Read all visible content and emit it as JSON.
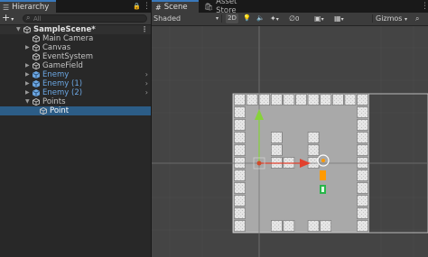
{
  "hierarchy": {
    "tab_label": "Hierarchy",
    "tab_icon": "☰",
    "lock_icon": "🔒",
    "menu_icon": "⋮",
    "add_label": "+",
    "add_caret": "▾",
    "search_placeholder": "All",
    "scene": {
      "name": "SampleScene*",
      "arrow": "▼",
      "more": "⋮"
    },
    "items": [
      {
        "label": "Main Camera",
        "indent": 1,
        "arrow": "",
        "prefab": false,
        "chevron": ""
      },
      {
        "label": "Canvas",
        "indent": 1,
        "arrow": "▶",
        "prefab": false,
        "chevron": ""
      },
      {
        "label": "EventSystem",
        "indent": 1,
        "arrow": "",
        "prefab": false,
        "chevron": ""
      },
      {
        "label": "GameField",
        "indent": 1,
        "arrow": "▶",
        "prefab": false,
        "chevron": ""
      },
      {
        "label": "Enemy",
        "indent": 1,
        "arrow": "▶",
        "prefab": true,
        "chevron": "›"
      },
      {
        "label": "Enemy (1)",
        "indent": 1,
        "arrow": "▶",
        "prefab": true,
        "chevron": "›"
      },
      {
        "label": "Enemy (2)",
        "indent": 1,
        "arrow": "▶",
        "prefab": true,
        "chevron": "›"
      },
      {
        "label": "Points",
        "indent": 1,
        "arrow": "▼",
        "prefab": false,
        "chevron": ""
      },
      {
        "label": "Point",
        "indent": 2,
        "arrow": "",
        "prefab": false,
        "chevron": "",
        "selected": true
      }
    ]
  },
  "scene": {
    "tabs": [
      {
        "label": "Scene",
        "icon": "#",
        "active": true
      },
      {
        "label": "Asset Store",
        "icon": "🛍",
        "active": false
      }
    ],
    "toolbar": {
      "shading_mode": "Shaded",
      "shading_caret": "▾",
      "mode_2d": "2D",
      "gizmos_label": "Gizmos",
      "gizmos_caret": "▾",
      "tab_menu_icon": "⋮",
      "light_icon": "💡",
      "audio_icon": "🔈",
      "fx_icon": "✦",
      "hidden_icon": "∅",
      "camera_icon": "▣",
      "grid_icon": "▦",
      "search_icon": "⌕"
    }
  },
  "colors": {
    "panel": "#282828",
    "selection": "#2c5d87",
    "prefab_text": "#6ca7e3",
    "viewport": "#444444",
    "field": "#a9a9a9",
    "accent": "#3a79bb"
  }
}
